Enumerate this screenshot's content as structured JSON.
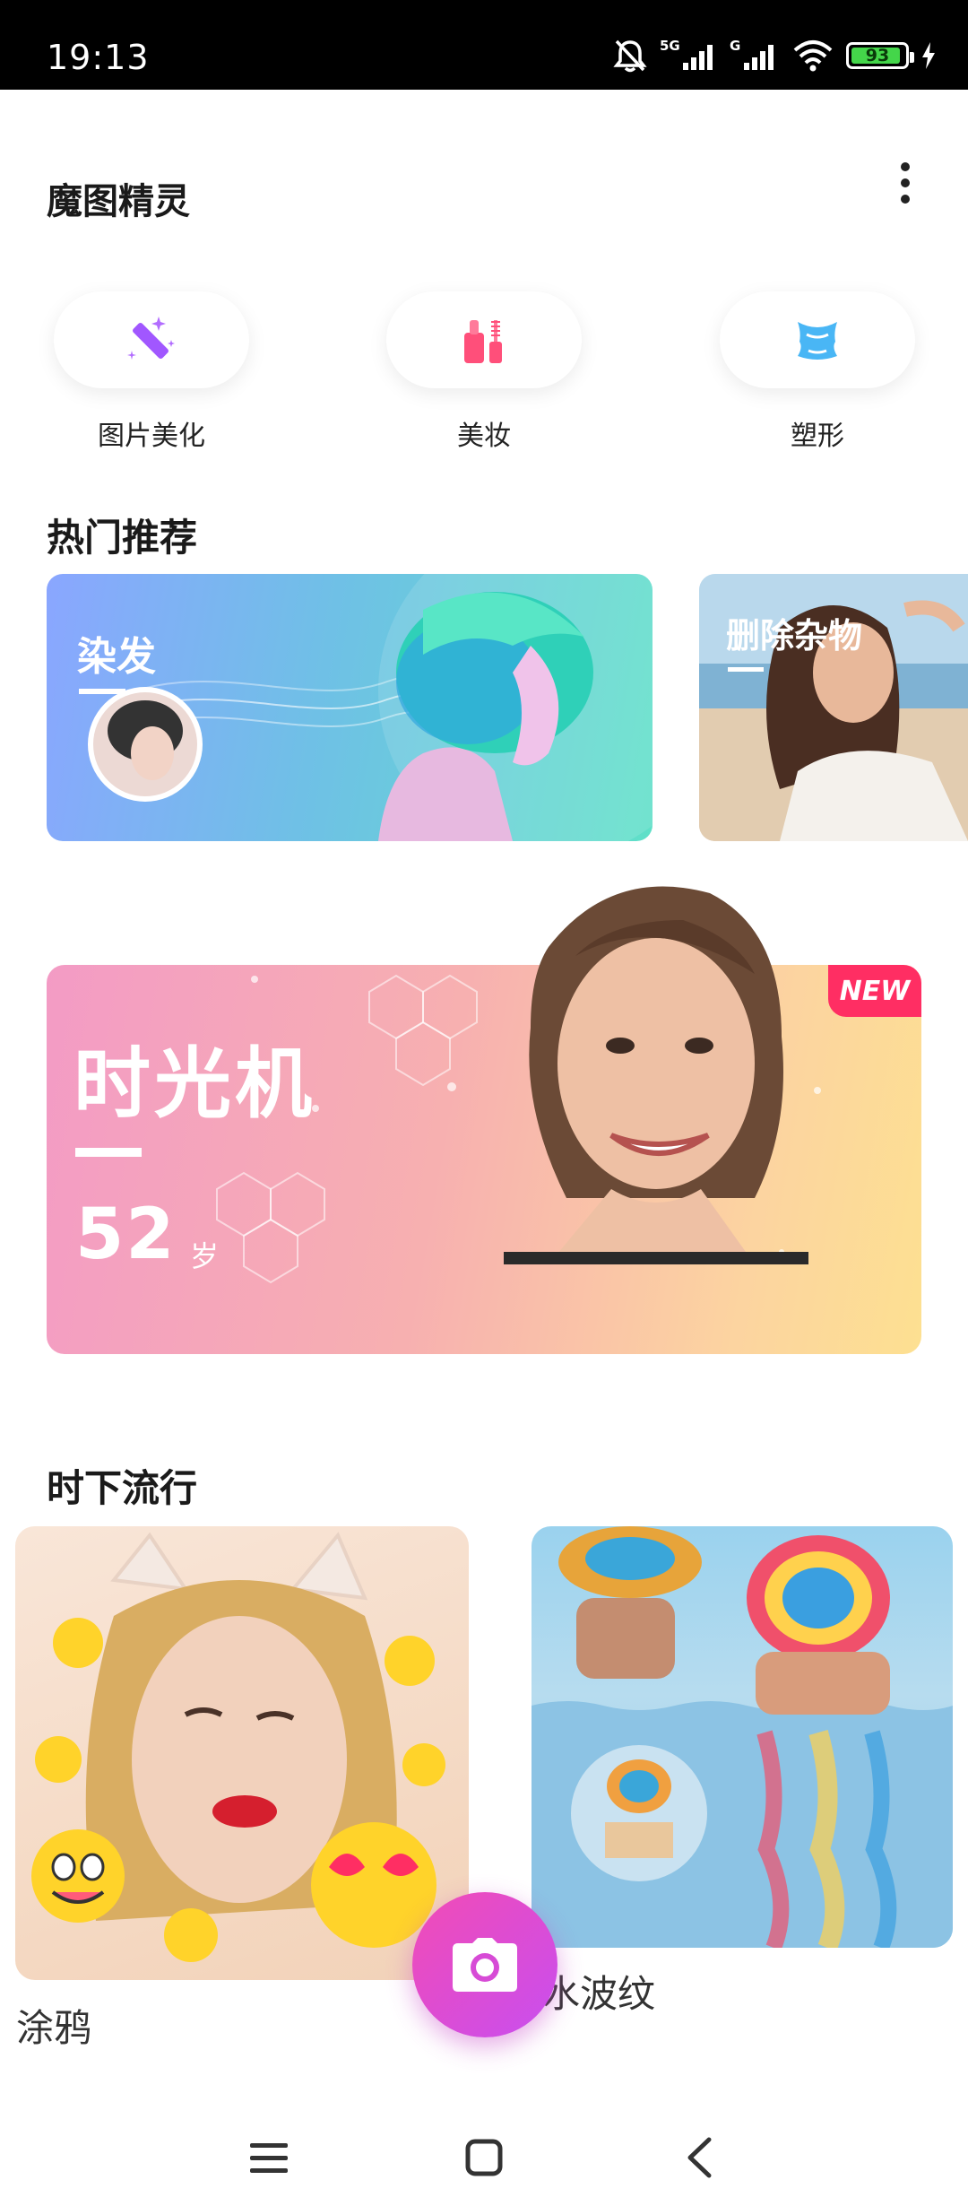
{
  "status_bar": {
    "time": "19:13",
    "battery_level": "93",
    "battery_fraction": 0.93,
    "icons": [
      "bell-muted-icon",
      "signal-5g-icon",
      "signal-g-icon",
      "wifi-icon",
      "battery-icon",
      "charging-icon"
    ],
    "network_1": "5G",
    "network_2": "G"
  },
  "header": {
    "title": "魔图精灵",
    "more_icon": "more-vertical-icon"
  },
  "tools": [
    {
      "label": "图片美化",
      "icon": "magic-wand-icon",
      "color": "#9b4dff"
    },
    {
      "label": "美妆",
      "icon": "makeup-icon",
      "color": "#ff4f7a"
    },
    {
      "label": "塑形",
      "icon": "body-shape-icon",
      "color": "#3aa9f0"
    }
  ],
  "hot": {
    "section_title": "热门推荐",
    "cards": [
      {
        "title": "染发"
      },
      {
        "title": "删除杂物"
      }
    ]
  },
  "time_machine": {
    "title": "时光机",
    "age_value": "52",
    "age_unit": "岁",
    "badge": "NEW"
  },
  "popular": {
    "section_title": "时下流行",
    "items": [
      {
        "label": "涂鸦"
      },
      {
        "label": "水波纹"
      }
    ]
  },
  "fab": {
    "icon": "camera-icon"
  },
  "nav": {
    "menu_icon": "menu-icon",
    "home_icon": "home-square-icon",
    "back_icon": "back-chevron-icon"
  },
  "colors": {
    "accent_pink": "#f24bb5",
    "accent_purple": "#c84ef0",
    "badge_red": "#ff2e63"
  }
}
